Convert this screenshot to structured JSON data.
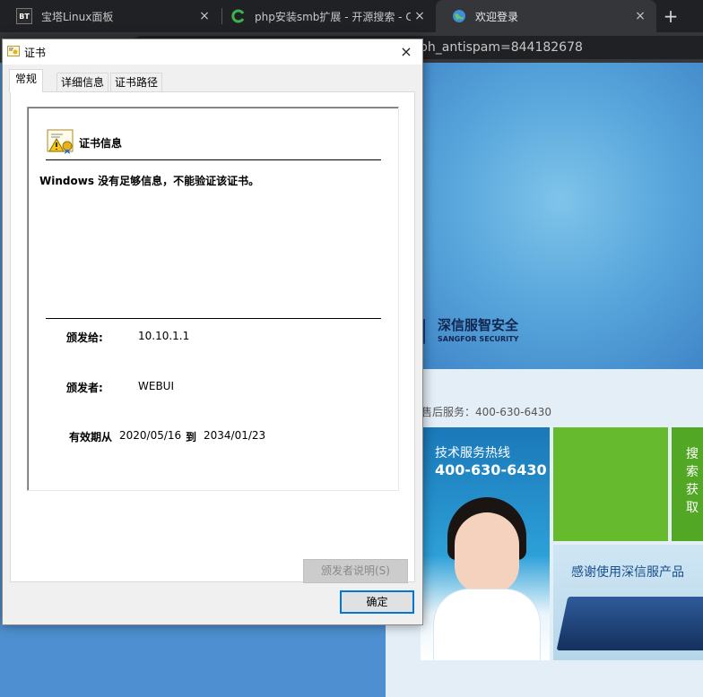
{
  "browser": {
    "tabs": [
      {
        "label": "宝塔Linux面板",
        "icon": "bt-logo-icon",
        "close": "×"
      },
      {
        "label": "php安装smb扩展 - 开源搜索 - C",
        "icon": "refresh-green-icon",
        "close": "×"
      },
      {
        "label": "欢迎登录",
        "icon": "globe-icon",
        "close": "×"
      }
    ],
    "new_tab": "+",
    "address_text": "ph_antispam=844182678"
  },
  "webpage": {
    "brand_cn": "深信服智安全",
    "brand_en": "SANGFOR SECURITY",
    "service_hotline_text": "售后服务：400-630-6430",
    "tile_hotline_title": "技术服务热线",
    "tile_hotline_number": "400-630-6430",
    "tile_side_text": "搜索获取",
    "tile_thanks": "感谢使用深信服产品"
  },
  "dialog": {
    "title": "证书",
    "close": "×",
    "tabs": [
      "常规",
      "详细信息",
      "证书路径"
    ],
    "info_heading": "证书信息",
    "warning": "Windows 没有足够信息，不能验证该证书。",
    "issued_to_label": "颁发给:",
    "issued_to_value": "10.10.1.1",
    "issued_by_label": "颁发者:",
    "issued_by_value": "WEBUI",
    "valid_from_label": "有效期从",
    "valid_from": "2020/05/16",
    "valid_to_label": "到",
    "valid_to": "2034/01/23",
    "issuer_statement_button": "颁发者说明(S)",
    "ok_button": "确定"
  }
}
